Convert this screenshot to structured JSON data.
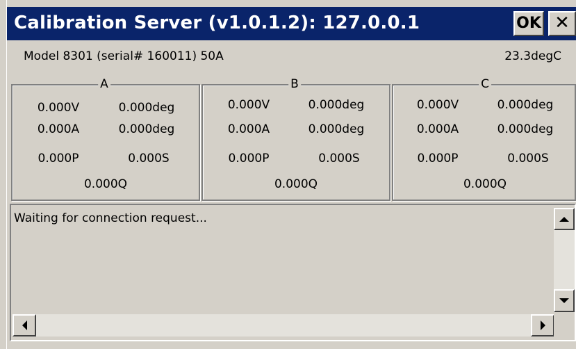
{
  "window": {
    "title": "Calibration Server (v1.0.1.2): 127.0.0.1",
    "ok_label": "OK",
    "close_label": "✕"
  },
  "header": {
    "model": "Model 8301 (serial# 160011) 50A",
    "temperature": "23.3degC"
  },
  "phases": [
    {
      "label": "A",
      "voltage": "0.000V",
      "voltage_angle": "0.000deg",
      "current": "0.000A",
      "current_angle": "0.000deg",
      "power_p": "0.000P",
      "power_s": "0.000S",
      "power_q": "0.000Q"
    },
    {
      "label": "B",
      "voltage": "0.000V",
      "voltage_angle": "0.000deg",
      "current": "0.000A",
      "current_angle": "0.000deg",
      "power_p": "0.000P",
      "power_s": "0.000S",
      "power_q": "0.000Q"
    },
    {
      "label": "C",
      "voltage": "0.000V",
      "voltage_angle": "0.000deg",
      "current": "0.000A",
      "current_angle": "0.000deg",
      "power_p": "0.000P",
      "power_s": "0.000S",
      "power_q": "0.000Q"
    }
  ],
  "log": {
    "text": "Waiting for connection request..."
  },
  "icons": {
    "scroll_up": "scroll-up-arrow-icon",
    "scroll_down": "scroll-down-arrow-icon",
    "scroll_left": "scroll-left-arrow-icon",
    "scroll_right": "scroll-right-arrow-icon"
  },
  "colors": {
    "titlebar": "#0a246a",
    "face": "#d4d0c8"
  }
}
